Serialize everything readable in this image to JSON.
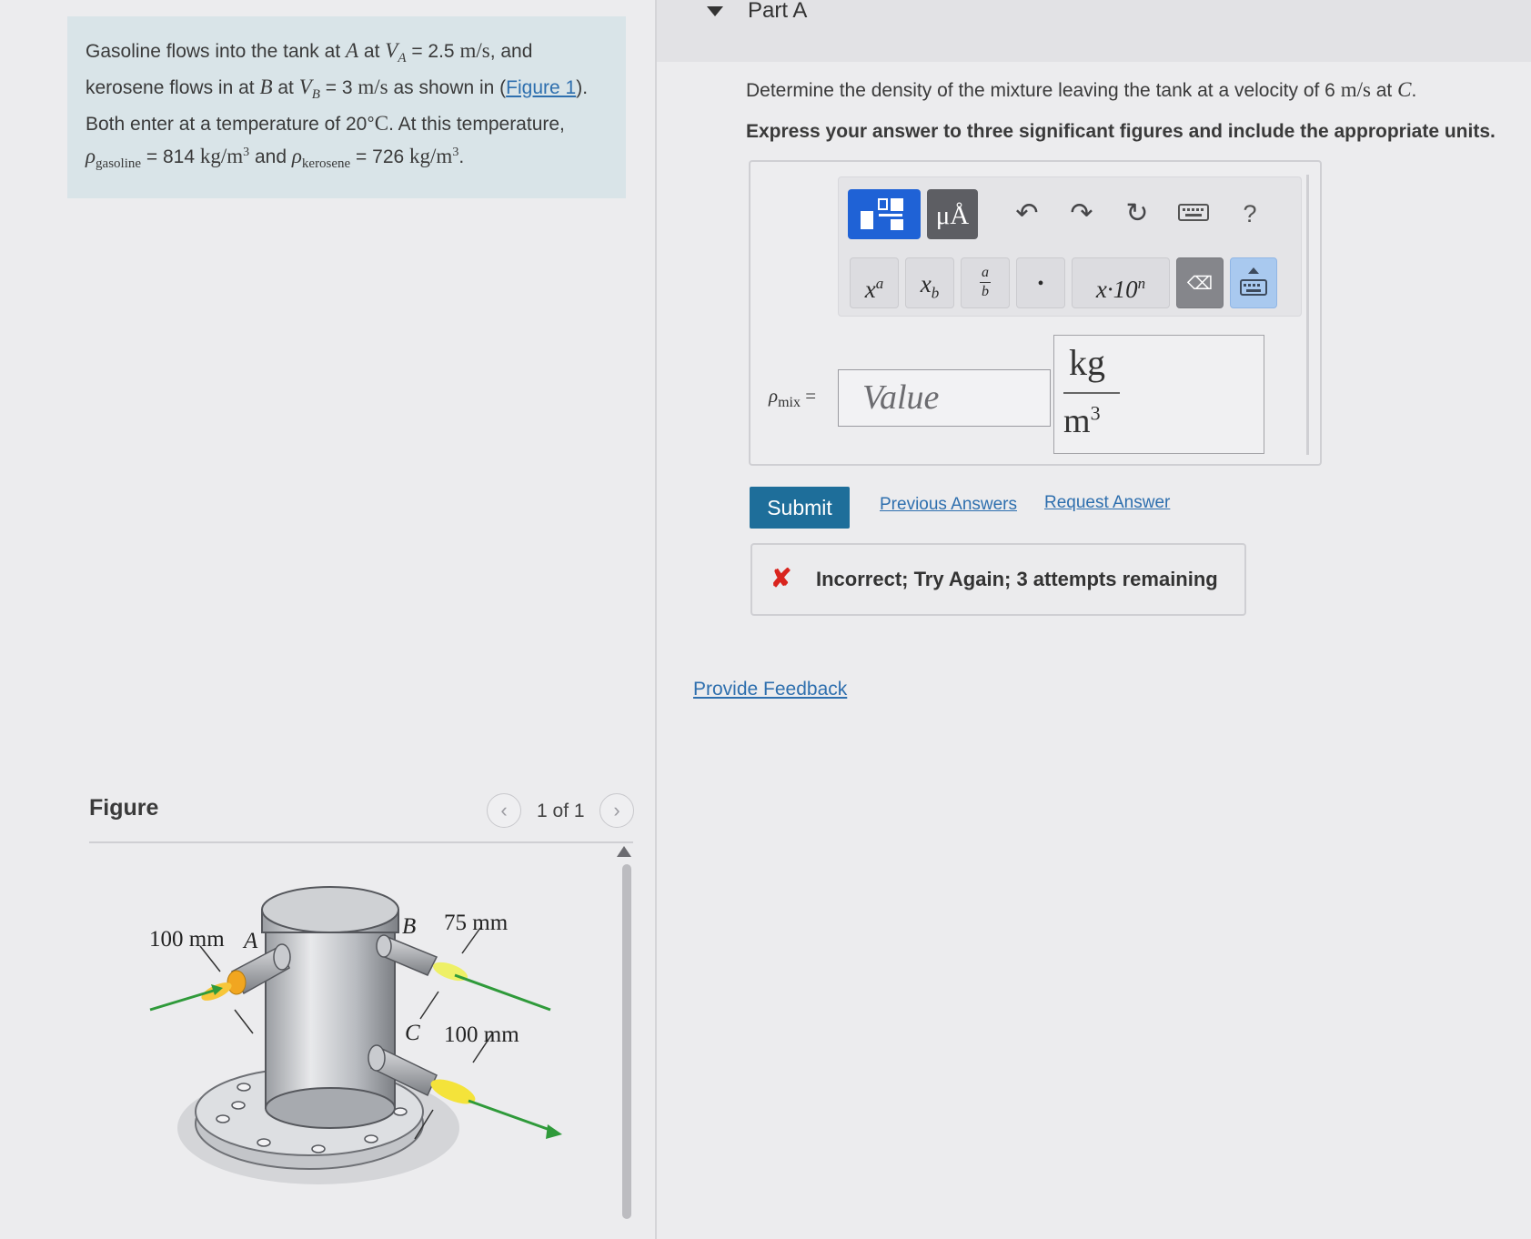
{
  "problem": {
    "t1": "Gasoline flows into the tank at ",
    "A": "A",
    "t2": " at ",
    "VA": "V",
    "VA_sub": "A",
    "t3": " = 2.5 ",
    "unit_ms": "m/s",
    "t4": ", and kerosene flows in at ",
    "B": "B",
    "t5": " at ",
    "VB": "V",
    "VB_sub": "B",
    "t6": " = 3 ",
    "t7": " as shown in (",
    "figure_link": "Figure 1",
    "t8": "). Both enter at a temperature of 20",
    "deg": "°",
    "C_unit": "C",
    "t9": ". At this temperature, ",
    "rho": "ρ",
    "rho_gas_sub": "gasoline",
    "t10": " = 814 ",
    "kgm": "kg/m",
    "cube": "3",
    "t11": " and ",
    "rho_ker_sub": "kerosene",
    "t12": " = 726",
    "t13": "."
  },
  "figure": {
    "title": "Figure",
    "pager": "1 of 1",
    "prev_icon": "chevron-left-icon",
    "next_icon": "chevron-right-icon",
    "labels": {
      "dim_a": "100 mm",
      "point_a": "A",
      "point_b": "B",
      "dim_b": "75 mm",
      "point_c": "C",
      "dim_c": "100 mm"
    }
  },
  "part": {
    "title": "Part A",
    "question_t1": "Determine the density of the mixture leaving the tank at a velocity of 6 ",
    "question_unit": "m/s",
    "question_t2": " at ",
    "question_C": "C",
    "question_t3": ".",
    "instructions": "Express your answer to three significant figures and include the appropriate units."
  },
  "toolbar": {
    "units_label": "μÅ",
    "undo_icon": "undo-icon",
    "redo_icon": "redo-icon",
    "reset_icon": "reset-icon",
    "keyboard_icon": "keyboard-icon",
    "help_label": "?",
    "superscript_label": "x",
    "superscript_exp": "a",
    "subscript_label": "x",
    "subscript_sub": "b",
    "fraction_num": "a",
    "fraction_den": "b",
    "dot_label": "•",
    "sci_label": "x·10",
    "sci_exp": "n",
    "backspace_label": "⌫"
  },
  "answer": {
    "variable": "ρ",
    "variable_sub": "mix",
    "equals": " =",
    "placeholder": "Value",
    "unit_num": "kg",
    "unit_den": "m",
    "unit_den_exp": "3"
  },
  "actions": {
    "submit": "Submit",
    "previous_answers": "Previous Answers",
    "request_answer": "Request Answer"
  },
  "feedback": {
    "icon": "✘",
    "message": "Incorrect; Try Again; 3 attempts remaining"
  },
  "provide_feedback": "Provide Feedback",
  "colors": {
    "accent_blue": "#1f62d6",
    "submit": "#1e6e9a",
    "error": "#d9241e",
    "link": "#2e6fae"
  }
}
